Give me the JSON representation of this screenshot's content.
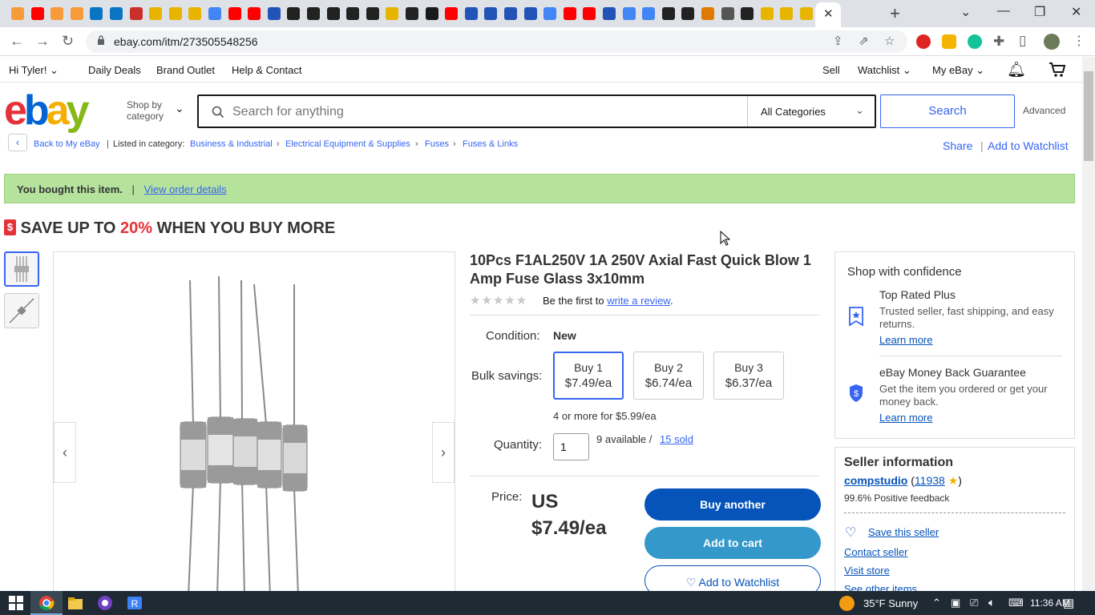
{
  "browser": {
    "url": "ebay.com/itm/273505548256",
    "tab_colors": [
      "#f79a3a",
      "#ff0000",
      "#f79a3a",
      "#f79a3a",
      "#0a75c2",
      "#0a75c2",
      "#c9302c",
      "#e7b500",
      "#e7b500",
      "#e7b500",
      "#4285f4",
      "#ff0000",
      "#ff0000",
      "#2254b8",
      "#222222",
      "#222222",
      "#222222",
      "#222222",
      "#222222",
      "#e7b500",
      "#222222",
      "#1a1a1a",
      "#ff0000",
      "#2254b8",
      "#2254b8",
      "#2254b8",
      "#2254b8",
      "#4285f4",
      "#ff0000",
      "#ff0000",
      "#2254b8",
      "#4285f4",
      "#4285f4",
      "#222222",
      "#222222",
      "#e07900",
      "#555555",
      "#222222",
      "#e7b500",
      "#e7b500",
      "#e7b500"
    ]
  },
  "topnav": {
    "greeting": "Hi Tyler!",
    "daily_deals": "Daily Deals",
    "brand_outlet": "Brand Outlet",
    "help": "Help & Contact",
    "sell": "Sell",
    "watchlist": "Watchlist",
    "my_ebay": "My eBay"
  },
  "header": {
    "logo_letters": [
      "e",
      "b",
      "a",
      "y"
    ],
    "shop_by": "Shop by",
    "category": "category",
    "search_placeholder": "Search for anything",
    "all_categories": "All Categories",
    "search_button": "Search",
    "advanced": "Advanced"
  },
  "breadcrumb": {
    "back": "Back to My eBay",
    "listed_in": "Listed in category:",
    "items": [
      "Business & Industrial",
      "Electrical Equipment & Supplies",
      "Fuses",
      "Fuses & Links"
    ],
    "share": "Share",
    "add_watchlist": "Add to Watchlist"
  },
  "banner": {
    "bought": "You bought this item.",
    "view_order": "View order details"
  },
  "promo": {
    "prefix": "SAVE UP TO ",
    "percent": "20%",
    "suffix": " WHEN YOU BUY MORE"
  },
  "item": {
    "title": "10Pcs F1AL250V 1A 250V Axial Fast Quick Blow 1 Amp Fuse Glass 3x10mm",
    "review_first": "Be the first to",
    "write_review": "write a review",
    "condition_label": "Condition:",
    "condition_value": "New",
    "bulk_label": "Bulk savings:",
    "bulk": [
      {
        "qty": "Buy 1",
        "price": "$7.49/ea"
      },
      {
        "qty": "Buy 2",
        "price": "$6.74/ea"
      },
      {
        "qty": "Buy 3",
        "price": "$6.37/ea"
      }
    ],
    "four_more": "4 or more for $5.99/ea",
    "quantity_label": "Quantity:",
    "quantity_value": "1",
    "available": "9 available /",
    "sold": "15 sold",
    "price_label": "Price:",
    "price_currency": "US",
    "price_value": "$7.49/ea",
    "buy_another": "Buy another",
    "add_to_cart": "Add to cart",
    "add_watchlist": "♡ Add to Watchlist"
  },
  "confidence": {
    "title": "Shop with confidence",
    "trp_title": "Top Rated Plus",
    "trp_text": "Trusted seller, fast shipping, and easy returns.",
    "learn_more": "Learn more",
    "mbg_title": "eBay Money Back Guarantee",
    "mbg_text": "Get the item you ordered or get your money back."
  },
  "seller": {
    "title": "Seller information",
    "name": "compstudio",
    "score": "11938",
    "feedback": "99.6% Positive feedback",
    "save": "Save this seller",
    "contact": "Contact seller",
    "visit": "Visit store",
    "see_other": "See other items"
  },
  "taskbar": {
    "temp": "35°F  Sunny",
    "time": "11:36 AM"
  }
}
